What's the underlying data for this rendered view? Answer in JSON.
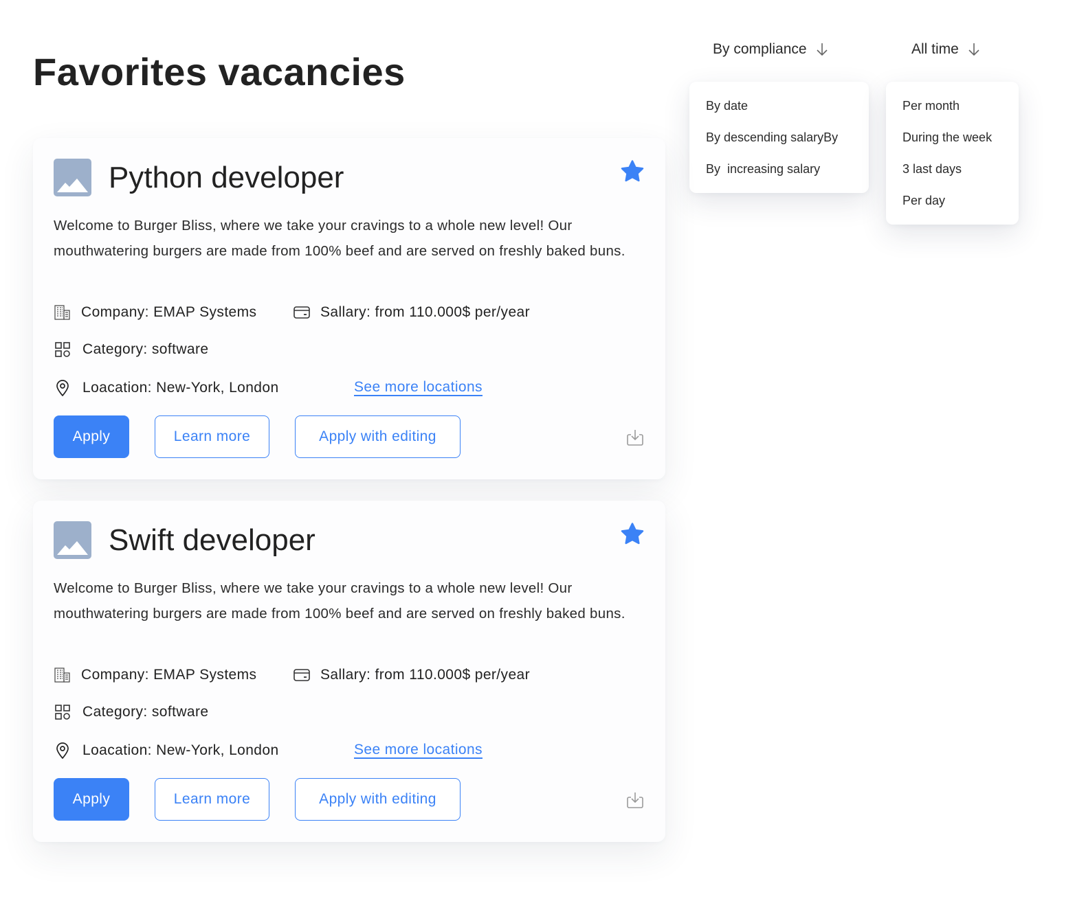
{
  "page": {
    "title": "Favorites vacancies"
  },
  "sort": {
    "compliance": {
      "label": "By compliance",
      "options": [
        "By date",
        "By descending salaryBy",
        "By  increasing salary"
      ]
    },
    "period": {
      "label": "All time",
      "options": [
        "Per month",
        "During the week",
        "3 last days",
        "Per day"
      ]
    }
  },
  "colors": {
    "accent": "#3b82f6",
    "thumbnail": "#9db0cb",
    "text": "#222222"
  },
  "vacancies": [
    {
      "title": "Python developer",
      "favorited": true,
      "description": "Welcome to Burger Bliss, where we take your cravings to a whole new level! Our mouthwatering burgers are made from 100% beef and are served on freshly baked buns.",
      "company": "Company: EMAP Systems",
      "salary": "Sallary: from 110.000$ per/year",
      "category": "Category: software",
      "location": "Loacation: New-York, London",
      "see_more": "See more locations",
      "buttons": {
        "apply": "Apply",
        "learn_more": "Learn more",
        "apply_editing": "Apply with editing"
      }
    },
    {
      "title": "Swift developer",
      "favorited": true,
      "description": "Welcome to Burger Bliss, where we take your cravings to a whole new level! Our mouthwatering burgers are made from 100% beef and are served on freshly baked buns.",
      "company": "Company: EMAP Systems",
      "salary": "Sallary: from 110.000$ per/year",
      "category": "Category: software",
      "location": "Loacation: New-York, London",
      "see_more": "See more locations",
      "buttons": {
        "apply": "Apply",
        "learn_more": "Learn more",
        "apply_editing": "Apply with editing"
      }
    }
  ],
  "icons": {
    "sort_arrow": "arrow-down-icon",
    "thumbnail": "image-placeholder-icon",
    "favorite": "star-icon",
    "company": "building-icon",
    "salary": "wallet-icon",
    "category": "grid-icon",
    "location": "map-pin-icon",
    "download": "download-icon"
  }
}
